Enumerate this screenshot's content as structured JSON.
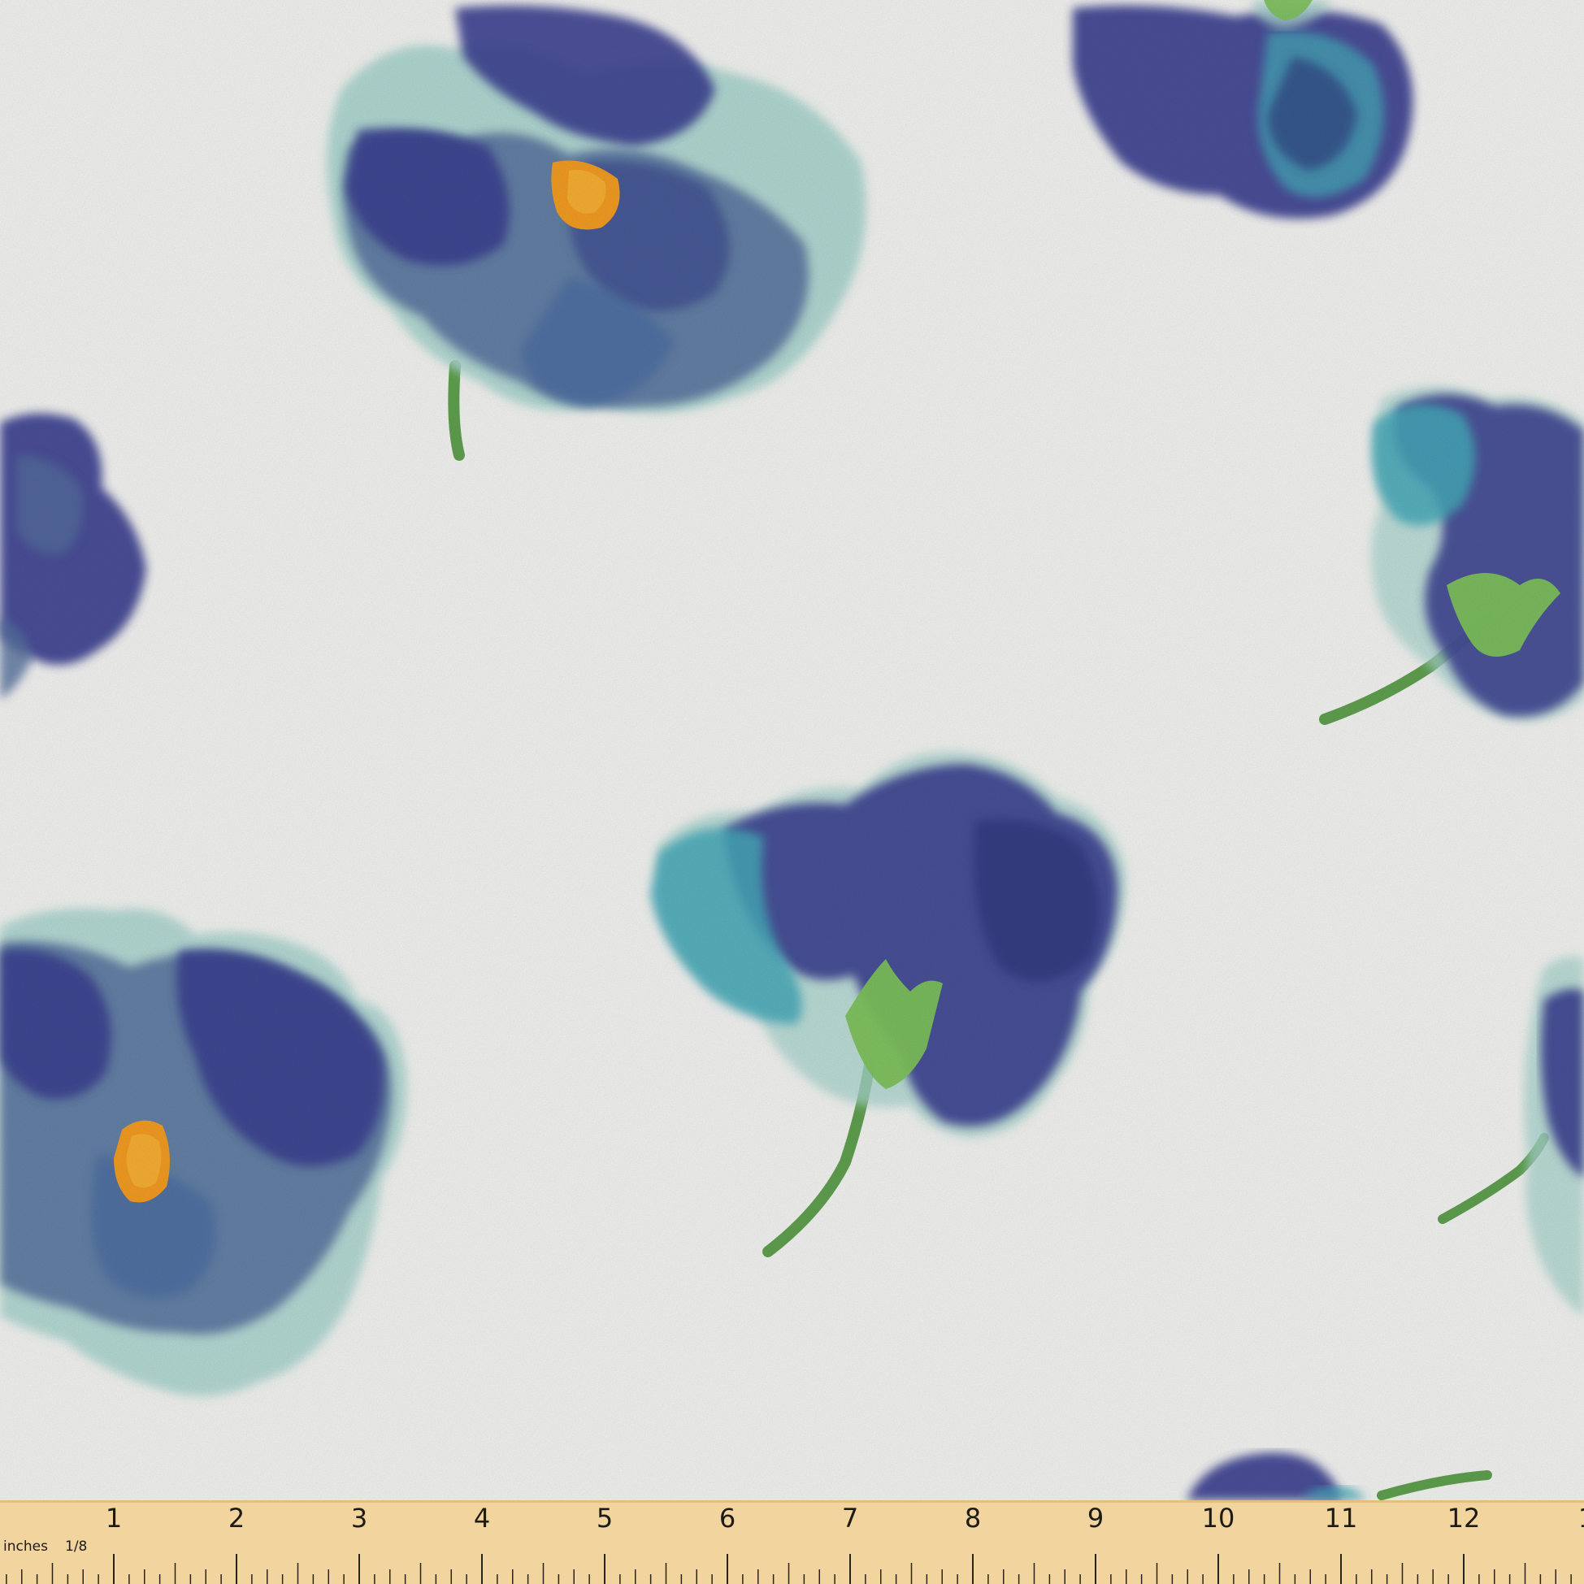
{
  "fabric": {
    "background_color": "#f1f1ef",
    "motif": "watercolor-pansy",
    "colors": {
      "indigo": "#3a418f",
      "navy": "#2c3276",
      "blue_gray": "#546f9c",
      "teal": "#44a8b8",
      "aqua": "#a8d3cc",
      "leaf_green": "#7cc05a",
      "stem_green": "#5e9e4e",
      "orange_center": "#f09a22"
    }
  },
  "ruler": {
    "unit_label": "inches",
    "fraction_label": "1/8",
    "numbers": [
      "1",
      "2",
      "3",
      "4",
      "5",
      "6",
      "7",
      "8",
      "9",
      "10",
      "11",
      "12",
      "1"
    ],
    "wood_color": "#f2d49e"
  }
}
